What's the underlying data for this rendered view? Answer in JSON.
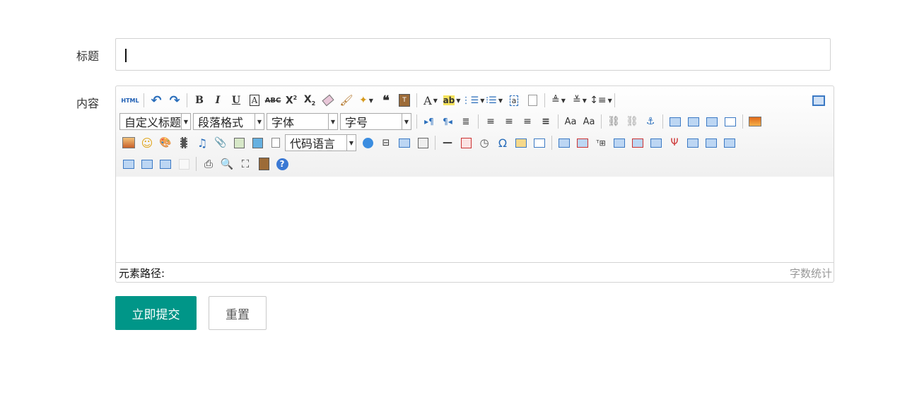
{
  "form": {
    "title_label": "标题",
    "title_value": "",
    "content_label": "内容"
  },
  "editor": {
    "toolbar": {
      "html_label": "HTML",
      "custom_title_select": "自定义标题",
      "paragraph_select": "段落格式",
      "font_family_select": "字体",
      "font_size_select": "字号",
      "code_language_select": "代码语言"
    },
    "status": {
      "element_path_label": "元素路径:",
      "word_count_label": "字数统计"
    },
    "colors": {
      "accent": "#009688",
      "icon_blue": "#3b79c4"
    }
  },
  "buttons": {
    "submit_label": "立即提交",
    "reset_label": "重置"
  }
}
